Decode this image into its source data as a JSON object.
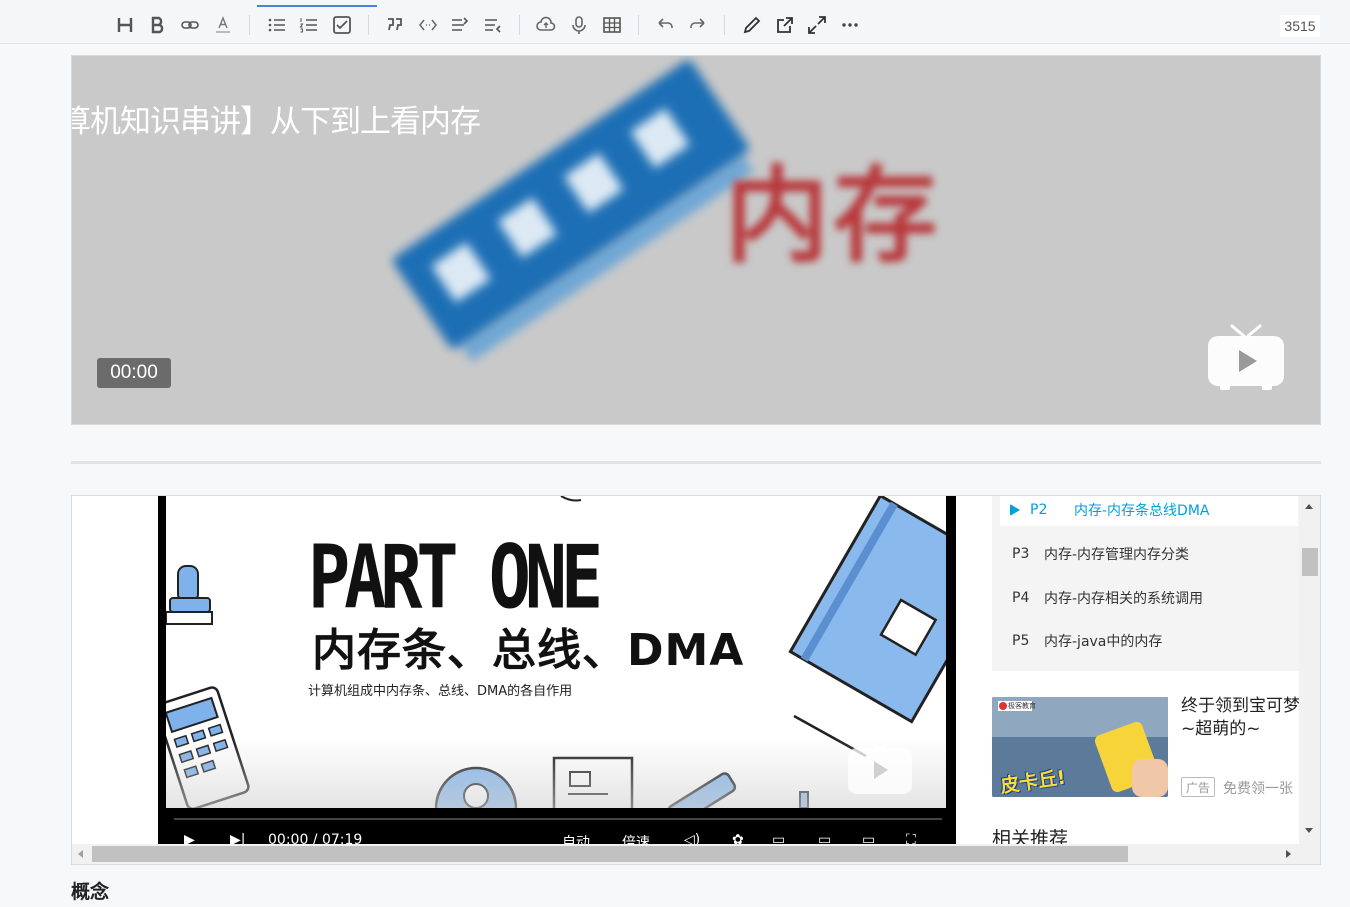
{
  "toolbar": {
    "icons": [
      "heading-icon",
      "bold-icon",
      "link-icon",
      "text-color-icon",
      "bullet-list-icon",
      "ordered-list-icon",
      "task-list-icon",
      "quote-icon",
      "code-icon",
      "indent-icon",
      "outdent-icon",
      "upload-icon",
      "microphone-icon",
      "table-icon",
      "undo-icon",
      "redo-icon",
      "edit-icon",
      "external-open-icon",
      "fullscreen-icon",
      "more-icon"
    ],
    "word_count": "3515"
  },
  "video1": {
    "title": "算机知识串讲】从下到上看内存",
    "big_text": "内存",
    "time": "00:00"
  },
  "player": {
    "slide_title": "PART ONE",
    "slide_subtitle": "内存条、总线、DMA",
    "slide_caption": "计算机组成中内存条、总线、DMA的各自作用",
    "time": "00:00 / 07:19",
    "auto": "自动",
    "speed": "倍速"
  },
  "episodes": [
    {
      "num": "P2",
      "title": "内存-内存条总线DMA",
      "active": true
    },
    {
      "num": "P3",
      "title": "内存-内存管理内存分类",
      "active": false
    },
    {
      "num": "P4",
      "title": "内存-内存相关的系统调用",
      "active": false
    },
    {
      "num": "P5",
      "title": "内存-java中的内存",
      "active": false
    }
  ],
  "ad": {
    "title": "终于领到宝可梦啦~超萌的~",
    "badge": "广告",
    "desc": "免费领一张",
    "thumb_text": "皮卡丘!",
    "brand_text": "极客教育"
  },
  "related_heading": "相关推荐",
  "section_heading": "概念"
}
